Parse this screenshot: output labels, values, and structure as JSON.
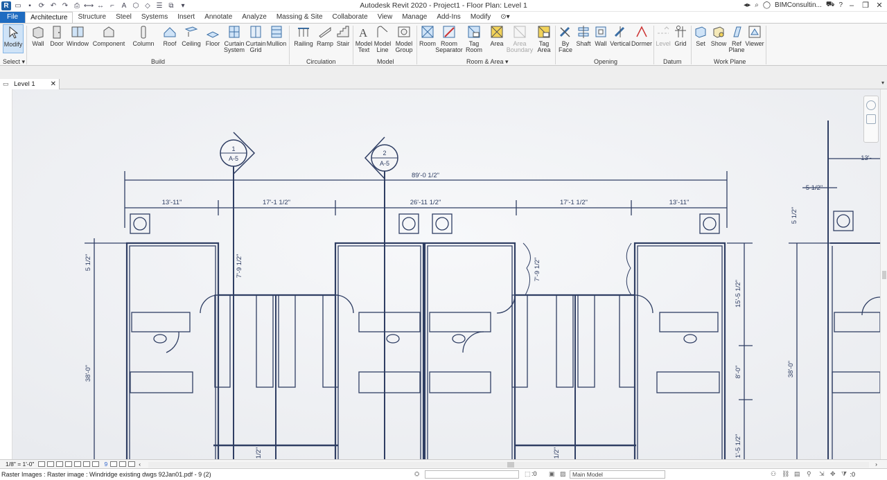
{
  "titlebar": {
    "title": "Autodesk Revit 2020 - Project1 - Floor Plan: Level 1",
    "user": "BIMConsultin...",
    "app_logo": "R"
  },
  "tabs": [
    "File",
    "Architecture",
    "Structure",
    "Steel",
    "Systems",
    "Insert",
    "Annotate",
    "Analyze",
    "Massing & Site",
    "Collaborate",
    "View",
    "Manage",
    "Add-Ins",
    "Modify"
  ],
  "ribbon": {
    "select": {
      "modify": "Modify",
      "label": "Select"
    },
    "build": {
      "label": "Build",
      "wall": "Wall",
      "door": "Door",
      "window": "Window",
      "component": "Component",
      "column": "Column",
      "roof": "Roof",
      "ceiling": "Ceiling",
      "floor": "Floor",
      "curtain_system_1": "Curtain",
      "curtain_system_2": "System",
      "curtain_grid_1": "Curtain",
      "curtain_grid_2": "Grid",
      "mullion": "Mullion"
    },
    "circulation": {
      "label": "Circulation",
      "railing": "Railing",
      "ramp": "Ramp",
      "stair": "Stair"
    },
    "model": {
      "label": "Model",
      "text_1": "Model",
      "text_2": "Text",
      "line_1": "Model",
      "line_2": "Line",
      "group_1": "Model",
      "group_2": "Group"
    },
    "room_area": {
      "label": "Room & Area",
      "room": "Room",
      "sep_1": "Room",
      "sep_2": "Separator",
      "tag_1": "Tag",
      "tag_2": "Room",
      "area": "Area",
      "boundary_1": "Area",
      "boundary_2": "Boundary",
      "tagarea_1": "Tag",
      "tagarea_2": "Area"
    },
    "opening": {
      "label": "Opening",
      "byface_1": "By",
      "byface_2": "Face",
      "shaft": "Shaft",
      "wall": "Wall",
      "vertical": "Vertical",
      "dormer": "Dormer"
    },
    "datum": {
      "label": "Datum",
      "level": "Level",
      "grid": "Grid"
    },
    "workplane": {
      "label": "Work Plane",
      "set": "Set",
      "show": "Show",
      "ref_1": "Ref",
      "ref_2": "Plane",
      "viewer": "Viewer"
    }
  },
  "view_tab": {
    "name": "Level 1"
  },
  "drawing": {
    "overall": "89'-0 1/2\"",
    "dims_top": [
      "13'-11\"",
      "17'-1 1/2\"",
      "26'-11 1/2\"",
      "17'-1 1/2\"",
      "13'-11\""
    ],
    "grid_1": "1",
    "grid_2": "2",
    "sheet_ref": "A-5",
    "left_dim_a": "5 1/2\"",
    "left_dim_b": "38'-0\"",
    "mid_dim_a": "7'-9 1/2\"",
    "mid_dim_b": "7'-9 1/2\"",
    "bottom_dim": "1/2\"",
    "bottom_dim_2": "1'-5 1/2\"",
    "right_dim_a": "15'-5 1/2\"",
    "right_dim_b": "8'-0\"",
    "far_right_dim_a": "5 1/2\"",
    "far_right_dim_b": "38'-0\"",
    "far_right_top": "13'-",
    "far_right_side": "5 1/2\""
  },
  "viewbar": {
    "scale": "1/8\" = 1'-0\"",
    "hidden_count": "9"
  },
  "status": {
    "text": "Raster Images : Raster image : Windridge existing dwgs 92Jan01.pdf - 9 (2)",
    "selection_count": ":0",
    "design_option": "Main Model",
    "filter_count": ":0"
  }
}
